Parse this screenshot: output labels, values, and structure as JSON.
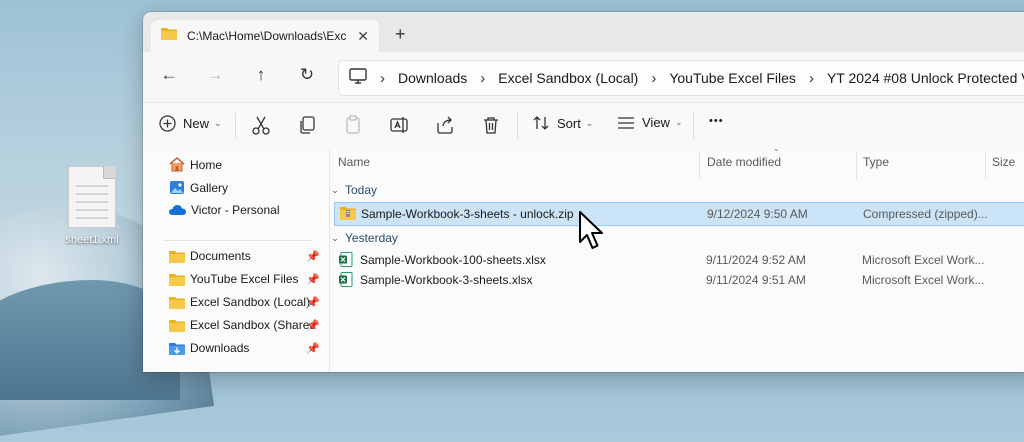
{
  "desktop": {
    "file_label": "sheet1.xml"
  },
  "window": {
    "tab_title": "C:\\Mac\\Home\\Downloads\\Exc",
    "tab_close": "✕",
    "new_tab": "+"
  },
  "nav": {
    "back": "←",
    "forward": "→",
    "up": "↑",
    "refresh": "↻"
  },
  "breadcrumb": [
    "Downloads",
    "Excel Sandbox (Local)",
    "YouTube Excel Files",
    "YT 2024 #08 Unlock Protected V"
  ],
  "breadcrumb_sep": "›",
  "commands": {
    "new_label": "New",
    "sort_label": "Sort",
    "view_label": "View",
    "more_label": "•••",
    "chevron": "⌄"
  },
  "sidebar": {
    "items": [
      {
        "label": "Home",
        "icon": "home-icon"
      },
      {
        "label": "Gallery",
        "icon": "gallery-icon"
      },
      {
        "label": "Victor - Personal",
        "icon": "onedrive-cloud-icon"
      },
      {
        "label": "Documents",
        "icon": "folder-icon",
        "pinned": true
      },
      {
        "label": "YouTube Excel Files",
        "icon": "folder-icon",
        "pinned": true
      },
      {
        "label": "Excel Sandbox (Local)",
        "icon": "folder-icon",
        "pinned": true
      },
      {
        "label": "Excel Sandbox (Shared",
        "icon": "folder-icon",
        "pinned": true
      },
      {
        "label": "Downloads",
        "icon": "downloads-folder-icon",
        "pinned": true
      }
    ],
    "pin_glyph": "📌"
  },
  "columns": [
    "Name",
    "Date modified",
    "Type",
    "Size"
  ],
  "groups": [
    {
      "label": "Today",
      "files": [
        {
          "name": "Sample-Workbook-3-sheets - unlock.zip",
          "date": "9/12/2024 9:50 AM",
          "type": "Compressed (zipped)...",
          "icon": "zip-folder-icon",
          "selected": true
        }
      ]
    },
    {
      "label": "Yesterday",
      "files": [
        {
          "name": "Sample-Workbook-100-sheets.xlsx",
          "date": "9/11/2024 9:52 AM",
          "type": "Microsoft Excel Work...",
          "icon": "excel-file-icon",
          "selected": false
        },
        {
          "name": "Sample-Workbook-3-sheets.xlsx",
          "date": "9/11/2024 9:51 AM",
          "type": "Microsoft Excel Work...",
          "icon": "excel-file-icon",
          "selected": false
        }
      ]
    }
  ],
  "colors": {
    "accent": "#0067c0",
    "selection": "#cce4f7",
    "folder": "#f4c542",
    "excel": "#1f7244"
  }
}
